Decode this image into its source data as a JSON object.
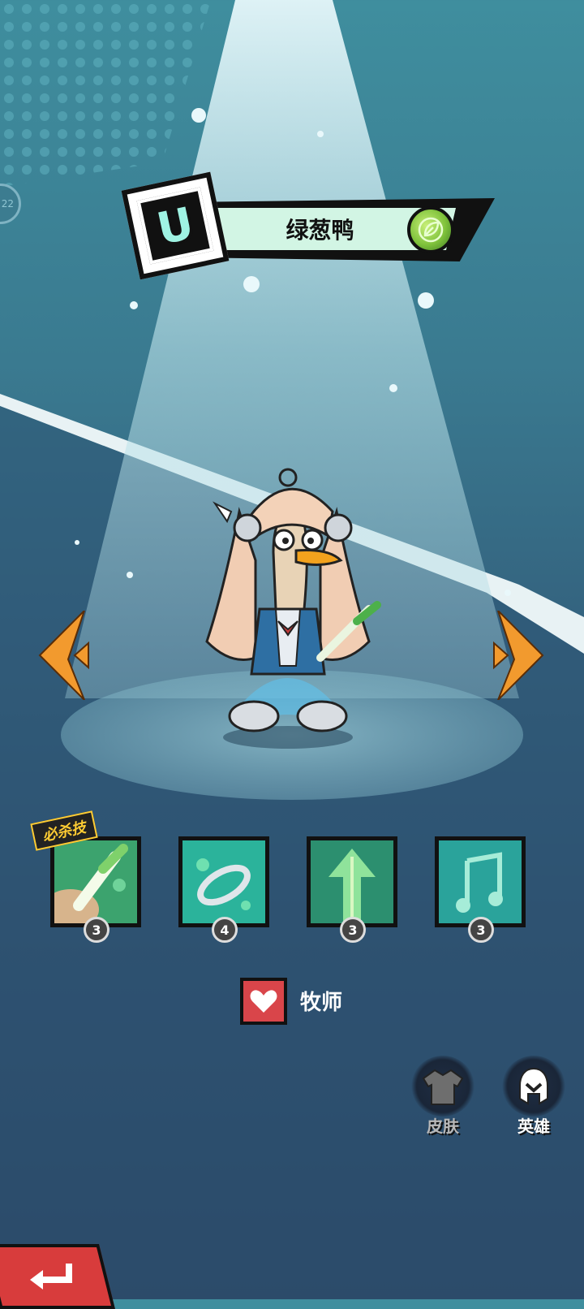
{
  "colors": {
    "background_top": "#3f8e9e",
    "background_bottom": "#2a3f5e",
    "spotlight": "#bde6ee",
    "arrow_orange": "#f29a2e",
    "rarity_letter": "#9ff3e3",
    "name_banner": "#d2f5e4",
    "role_red": "#d9454a",
    "back_red": "#d83c3c"
  },
  "side_tab": {
    "text": "22"
  },
  "hero": {
    "rarity": "U",
    "name": "绿葱鸭",
    "element_icon": "leaf-element-icon",
    "role_icon": "heart-icon",
    "role": "牧师"
  },
  "navigation": {
    "prev_icon": "arrow-left-icon",
    "next_icon": "arrow-right-icon"
  },
  "skills": {
    "ultimate_label": "必杀技",
    "items": [
      {
        "icon": "scallion-slash-icon",
        "level": "3"
      },
      {
        "icon": "whirl-ring-icon",
        "level": "4"
      },
      {
        "icon": "arrow-up-buff-icon",
        "level": "3"
      },
      {
        "icon": "music-note-icon",
        "level": "3"
      }
    ]
  },
  "buttons": {
    "skin_label": "皮肤",
    "hero_label": "英雄",
    "back_icon": "return-arrow-icon"
  }
}
